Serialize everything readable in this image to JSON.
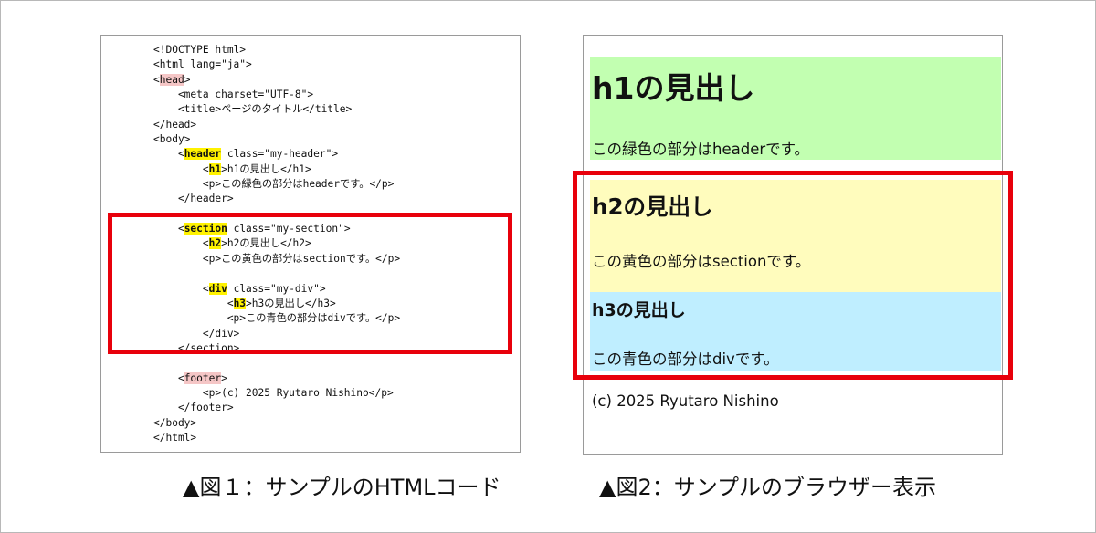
{
  "code_panel": {
    "lines": [
      [
        {
          "t": "<!DOCTYPE html>"
        }
      ],
      [
        {
          "t": "<html lang=\"ja\">"
        }
      ],
      [
        {
          "t": "<"
        },
        {
          "t": "head",
          "hl": "pink"
        },
        {
          "t": ">"
        }
      ],
      [
        {
          "t": "    <meta charset=\"UTF-8\">"
        }
      ],
      [
        {
          "t": "    <title>ページのタイトル</title>"
        }
      ],
      [
        {
          "t": "</head>"
        }
      ],
      [
        {
          "t": "<body>"
        }
      ],
      [
        {
          "t": "    <"
        },
        {
          "t": "header",
          "hl": "yellow"
        },
        {
          "t": " class=\"my-header\">"
        }
      ],
      [
        {
          "t": "        <"
        },
        {
          "t": "h1",
          "hl": "yellow"
        },
        {
          "t": ">h1の見出し</h1>"
        }
      ],
      [
        {
          "t": "        <p>この緑色の部分はheaderです。</p>"
        }
      ],
      [
        {
          "t": "    </header>"
        }
      ],
      [
        {
          "t": ""
        }
      ],
      [
        {
          "t": "    <"
        },
        {
          "t": "section",
          "hl": "yellow"
        },
        {
          "t": " class=\"my-section\">"
        }
      ],
      [
        {
          "t": "        <"
        },
        {
          "t": "h2",
          "hl": "yellow"
        },
        {
          "t": ">h2の見出し</h2>"
        }
      ],
      [
        {
          "t": "        <p>この黄色の部分はsectionです。</p>"
        }
      ],
      [
        {
          "t": ""
        }
      ],
      [
        {
          "t": "        <"
        },
        {
          "t": "div",
          "hl": "yellow"
        },
        {
          "t": " class=\"my-div\">"
        }
      ],
      [
        {
          "t": "            <"
        },
        {
          "t": "h3",
          "hl": "yellow"
        },
        {
          "t": ">h3の見出し</h3>"
        }
      ],
      [
        {
          "t": "            <p>この青色の部分はdivです。</p>"
        }
      ],
      [
        {
          "t": "        </div>"
        }
      ],
      [
        {
          "t": "    </section>"
        }
      ],
      [
        {
          "t": ""
        }
      ],
      [
        {
          "t": "    <"
        },
        {
          "t": "footer",
          "hl": "pink"
        },
        {
          "t": ">"
        }
      ],
      [
        {
          "t": "        <p>(c) 2025 Ryutaro Nishino</p>"
        }
      ],
      [
        {
          "t": "    </footer>"
        }
      ],
      [
        {
          "t": "</body>"
        }
      ],
      [
        {
          "t": "</html>"
        }
      ]
    ]
  },
  "browser_panel": {
    "h1": "h1の見出し",
    "header_text": "この緑色の部分はheaderです。",
    "h2": "h2の見出し",
    "section_text": "この黄色の部分はsectionです。",
    "h3": "h3の見出し",
    "div_text": "この青色の部分はdivです。",
    "footer_text": "(c) 2025 Ryutaro Nishino"
  },
  "captions": {
    "fig1": "▲図１：サンプルのHTMLコード",
    "fig2": "▲図2：サンプルのブラウザー表示"
  },
  "colors": {
    "highlight_yellow": "#fff200",
    "highlight_pink": "#f5c6c6",
    "header_bg": "#c2ffb1",
    "section_bg": "#fffcbd",
    "div_bg": "#bfeeff",
    "red_frame": "#e8000b"
  }
}
